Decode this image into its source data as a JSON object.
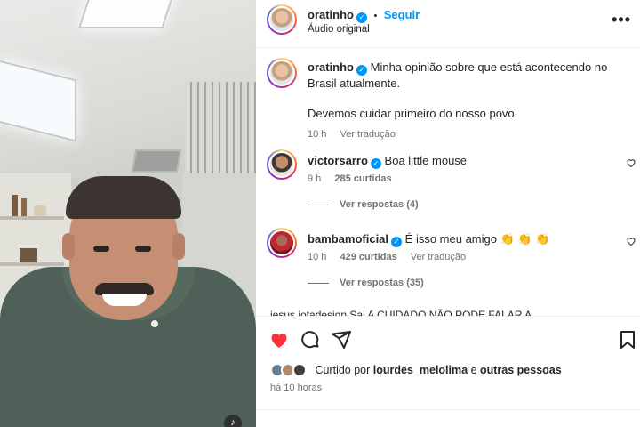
{
  "post": {
    "author": "oratinho",
    "follow_label": "Seguir",
    "audio": "Áudio original",
    "separator": "•",
    "more": "•••"
  },
  "caption": {
    "author": "oratinho",
    "text1": "Minha opinião sobre que está acontecendo no Brasil atualmente.",
    "text2": "Devemos cuidar primeiro do nosso povo.",
    "time": "10 h",
    "translate": "Ver tradução"
  },
  "comments": [
    {
      "author": "victorsarro",
      "text": "Boa little mouse",
      "time": "9 h",
      "likes": "285 curtidas",
      "replies": "Ver respostas (4)"
    },
    {
      "author": "bambamoficial",
      "text": "É isso meu amigo 👏 👏 👏",
      "time": "10 h",
      "likes": "429 curtidas",
      "translate": "Ver tradução",
      "replies": "Ver respostas (35)"
    }
  ],
  "partial_comment": "jesus.jotadesign Sai A CUIDADO NÃO PODE FALAR A",
  "footer": {
    "liked_prefix": "Curtido por",
    "liked_user": "lourdes_melolima",
    "liked_suffix": "e",
    "liked_others": "outras pessoas",
    "time": "há 10 horas"
  },
  "icons": {
    "like": "heart-filled-icon",
    "comment": "comment-icon",
    "share": "send-icon",
    "save": "bookmark-icon",
    "sound": "speaker-icon"
  },
  "colors": {
    "link": "#0095f6",
    "like_red": "#ff3040",
    "muted": "#737373"
  }
}
